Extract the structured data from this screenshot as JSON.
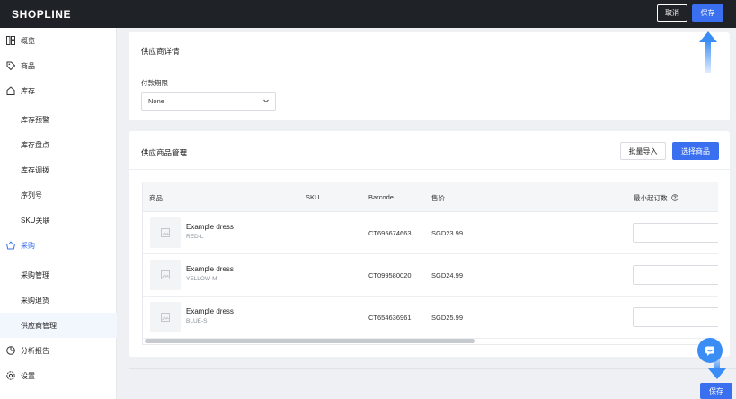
{
  "topbar": {
    "logo": "SHOPLINE",
    "cancel_label": "取消",
    "save_label": "保存"
  },
  "sidebar": {
    "items": [
      {
        "label": "概览",
        "icon": "dashboard-icon"
      },
      {
        "label": "商品",
        "icon": "tag-icon"
      },
      {
        "label": "库存",
        "icon": "home-icon"
      },
      {
        "label": "库存预警"
      },
      {
        "label": "库存盘点"
      },
      {
        "label": "库存调拨"
      },
      {
        "label": "序列号"
      },
      {
        "label": "SKU关联"
      },
      {
        "label": "采购",
        "icon": "basket-icon"
      },
      {
        "label": "采购管理"
      },
      {
        "label": "采购退货"
      },
      {
        "label": "供应商管理"
      },
      {
        "label": "分析报告",
        "icon": "pie-chart-icon"
      },
      {
        "label": "设置",
        "icon": "gear-icon"
      }
    ]
  },
  "supplier_details": {
    "title": "供应商详情",
    "payment_terms_label": "付款期限",
    "payment_terms_value": "None"
  },
  "supplier_products": {
    "title": "供应商品管理",
    "bulk_import_label": "批量导入",
    "select_products_label": "选择商品",
    "columns": [
      "商品",
      "SKU",
      "Barcode",
      "售价",
      "最小起订数"
    ],
    "rows": [
      {
        "name": "Example dress",
        "variant": "RED-L",
        "sku": "",
        "barcode": "CT695674663",
        "price": "SGD23.99"
      },
      {
        "name": "Example dress",
        "variant": "YELLOW-M",
        "sku": "",
        "barcode": "CT099580020",
        "price": "SGD24.99"
      },
      {
        "name": "Example dress",
        "variant": "BLUE-S",
        "sku": "",
        "barcode": "CT654636961",
        "price": "SGD25.99"
      }
    ]
  },
  "bottom": {
    "save_label": "保存"
  },
  "colors": {
    "primary": "#3a6ff0",
    "topbar": "#1f2227",
    "accent_arrow": "#3a8df5"
  }
}
